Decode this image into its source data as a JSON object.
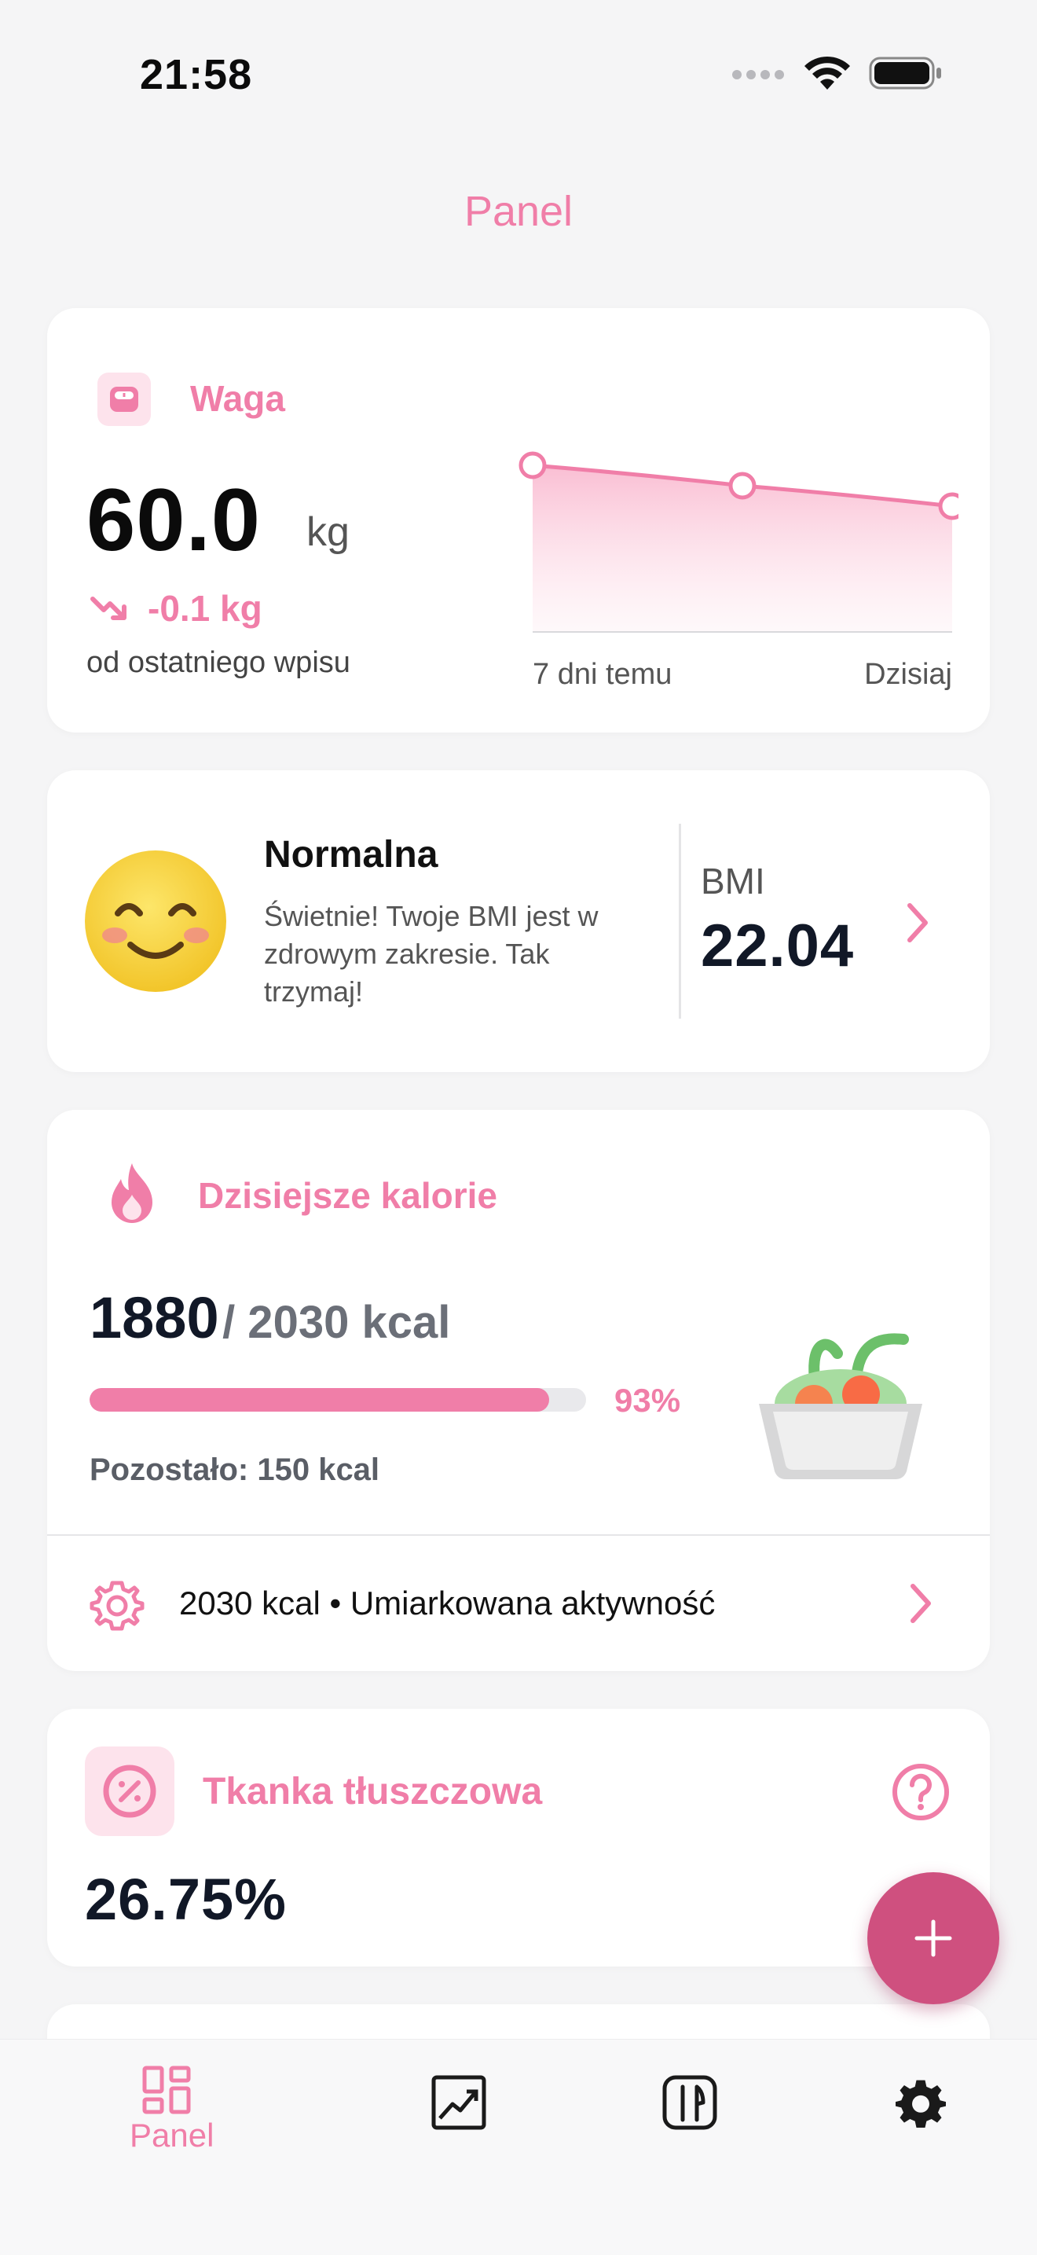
{
  "status_bar": {
    "time": "21:58"
  },
  "nav": {
    "title": "Panel"
  },
  "weight_card": {
    "title": "Waga",
    "value": "60.0",
    "unit": "kg",
    "change": "-0.1 kg",
    "change_caption": "od ostatniego wpisu",
    "chart": {
      "x_start_label": "7 dni temu",
      "x_end_label": "Dzisiaj"
    }
  },
  "chart_data": {
    "type": "area",
    "x": [
      "7 dni temu",
      "",
      "Dzisiaj"
    ],
    "values": [
      60.1,
      60.05,
      60.0
    ],
    "xlabel": "",
    "ylabel": "",
    "title": ""
  },
  "bmi_card": {
    "category": "Normalna",
    "description": "Świetnie! Twoje BMI jest w zdrowym zakresie. Tak trzymaj!",
    "label": "BMI",
    "value": "22.04"
  },
  "calories_card": {
    "title": "Dzisiejsze kalorie",
    "consumed": "1880",
    "target": "/ 2030 kcal",
    "progress_fraction": 0.926,
    "progress_label": "93%",
    "remaining": "Pozostało: 150 kcal",
    "settings_text": "2030 kcal • Umiarkowana aktywność"
  },
  "body_fat_card": {
    "title": "Tkanka tłuszczowa",
    "value": "26.75%"
  },
  "tab_bar": {
    "active_label": "Panel",
    "tabs": [
      {
        "icon": "dashboard-icon",
        "label": "Panel"
      },
      {
        "icon": "chart-icon"
      },
      {
        "icon": "fork-knife-icon"
      },
      {
        "icon": "gear-icon"
      }
    ]
  },
  "colors": {
    "accent": "#f07ea8",
    "fab": "#cf507f"
  }
}
